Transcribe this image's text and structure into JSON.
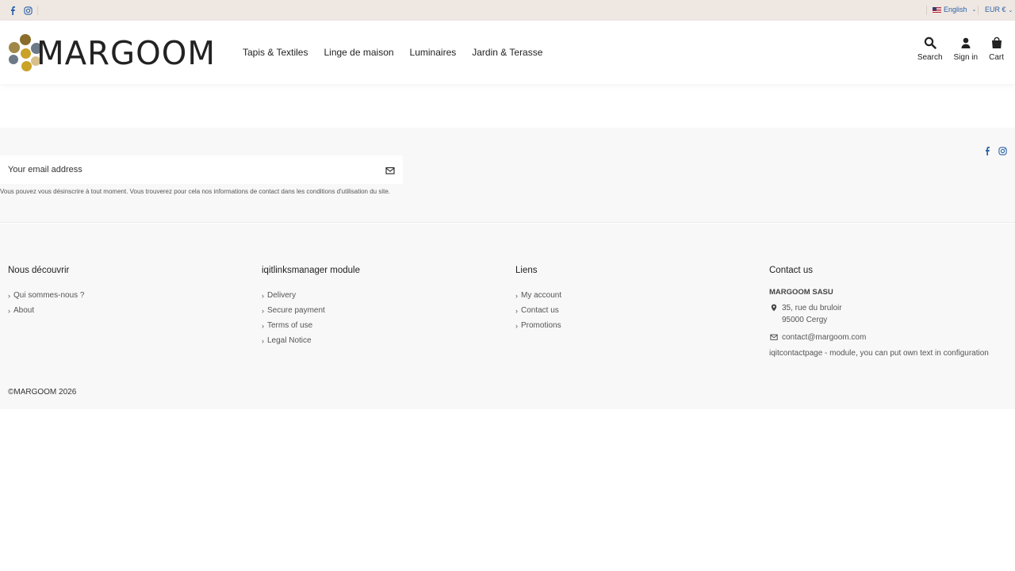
{
  "topbar": {
    "language": "English",
    "currency": "EUR €"
  },
  "header": {
    "logo_text": "MARGOOM",
    "nav": [
      "Tapis & Textiles",
      "Linge de maison",
      "Luminaires",
      "Jardin & Terasse"
    ],
    "search_label": "Search",
    "signin_label": "Sign in",
    "cart_label": "Cart"
  },
  "newsletter": {
    "placeholder": "Your email address",
    "note": "Vous pouvez vous désinscrire à tout moment. Vous trouverez pour cela nos informations de contact dans les conditions d'utilisation du site."
  },
  "footer": {
    "col1": {
      "title": "Nous découvrir",
      "links": [
        "Qui sommes-nous ?",
        "About"
      ]
    },
    "col2": {
      "title": "iqitlinksmanager module",
      "links": [
        "Delivery",
        "Secure payment",
        "Terms of use",
        "Legal Notice"
      ]
    },
    "col3": {
      "title": "Liens",
      "links": [
        "My account",
        "Contact us",
        "Promotions"
      ]
    },
    "contact": {
      "title": "Contact us",
      "company": "MARGOOM SASU",
      "address_line1": "35, rue du bruloir",
      "address_line2": "95000 Cergy",
      "email": "contact@margoom.com",
      "extra": "iqitcontactpage - module, you can put own text in configuration"
    },
    "copyright": "©MARGOOM 2026"
  },
  "colors": {
    "topbar_bg": "#efe7e2",
    "link_blue": "#2b63a8",
    "footer_bg": "#f8f8f8",
    "logo_gold": "#c9a227",
    "logo_brown": "#8a6d2b",
    "logo_gray": "#6b7a86"
  }
}
